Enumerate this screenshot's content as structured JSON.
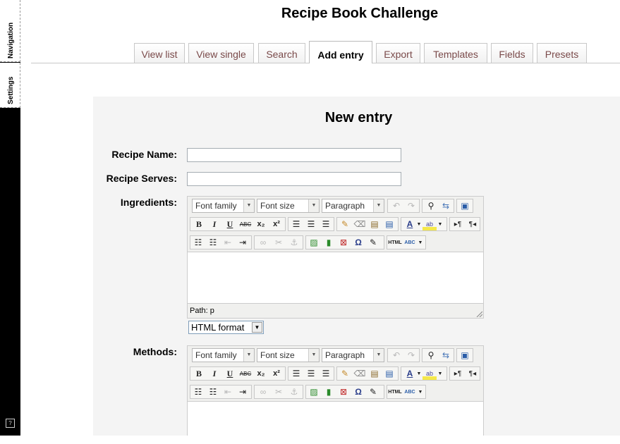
{
  "dock": {
    "navigation_label": "Navigation",
    "settings_label": "Settings",
    "help_glyph": "?"
  },
  "page": {
    "heading": "Recipe Book Challenge"
  },
  "tabs": [
    {
      "label": "View list",
      "active": false
    },
    {
      "label": "View single",
      "active": false
    },
    {
      "label": "Search",
      "active": false
    },
    {
      "label": "Add entry",
      "active": true
    },
    {
      "label": "Export",
      "active": false
    },
    {
      "label": "Templates",
      "active": false
    },
    {
      "label": "Fields",
      "active": false
    },
    {
      "label": "Presets",
      "active": false
    }
  ],
  "form": {
    "title": "New entry",
    "recipe_name": {
      "label": "Recipe Name:",
      "value": ""
    },
    "recipe_serves": {
      "label": "Recipe Serves:",
      "value": ""
    },
    "ingredients": {
      "label": "Ingredients:"
    },
    "methods": {
      "label": "Methods:"
    },
    "format_select": "HTML format"
  },
  "editor": {
    "font_family": "Font family",
    "font_size": "Font size",
    "paragraph": "Paragraph",
    "path": "Path: p",
    "icons": {
      "bold": "B",
      "italic": "I",
      "underline": "U",
      "strikethrough": "ABC",
      "subscript": "x₂",
      "superscript": "x²",
      "html_label": "HTML",
      "spell_label": "ABC"
    }
  },
  "colors": {
    "tab_text": "#7a4a4a",
    "panel_bg": "#f4f4f4",
    "dock_bg": "#000000"
  }
}
